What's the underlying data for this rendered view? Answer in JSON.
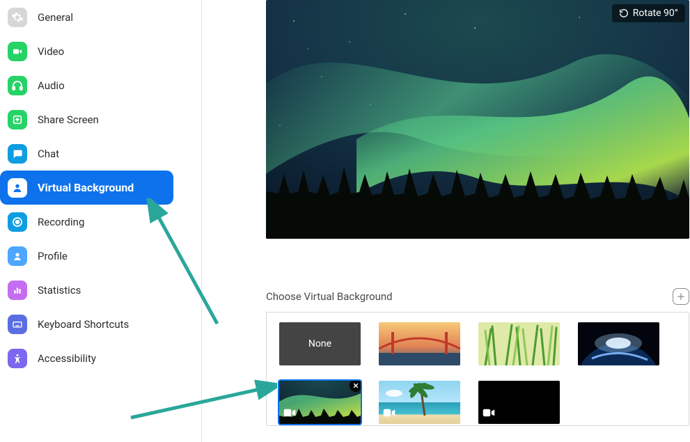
{
  "sidebar": {
    "items": [
      {
        "label": "General",
        "icon": "gear",
        "color": "#d7d7d7",
        "selected": false
      },
      {
        "label": "Video",
        "icon": "video",
        "color": "#25d366",
        "selected": false
      },
      {
        "label": "Audio",
        "icon": "headphones",
        "color": "#25d366",
        "selected": false
      },
      {
        "label": "Share Screen",
        "icon": "share",
        "color": "#25d366",
        "selected": false
      },
      {
        "label": "Chat",
        "icon": "chat",
        "color": "#0e9de0",
        "selected": false
      },
      {
        "label": "Virtual Background",
        "icon": "person",
        "color": "#ffffff",
        "selected": true
      },
      {
        "label": "Recording",
        "icon": "record",
        "color": "#0e9de0",
        "selected": false
      },
      {
        "label": "Profile",
        "icon": "profile",
        "color": "#4da6ff",
        "selected": false
      },
      {
        "label": "Statistics",
        "icon": "stats",
        "color": "#c56cf0",
        "selected": false
      },
      {
        "label": "Keyboard Shortcuts",
        "icon": "keyboard",
        "color": "#5b6ee1",
        "selected": false
      },
      {
        "label": "Accessibility",
        "icon": "a11y",
        "color": "#7b68ee",
        "selected": false
      }
    ]
  },
  "preview": {
    "rotate_label": "Rotate 90°",
    "background_name": "aurora"
  },
  "choose": {
    "label": "Choose Virtual Background"
  },
  "thumbs": [
    {
      "name": "none",
      "label": "None",
      "selected": false,
      "video": false,
      "removable": false
    },
    {
      "name": "bridge",
      "label": "",
      "selected": false,
      "video": false,
      "removable": false
    },
    {
      "name": "grass",
      "label": "",
      "selected": false,
      "video": false,
      "removable": false
    },
    {
      "name": "earth",
      "label": "",
      "selected": false,
      "video": false,
      "removable": false
    },
    {
      "name": "aurora",
      "label": "",
      "selected": true,
      "video": true,
      "removable": true
    },
    {
      "name": "beach",
      "label": "",
      "selected": false,
      "video": true,
      "removable": false
    },
    {
      "name": "black",
      "label": "",
      "selected": false,
      "video": true,
      "removable": false
    }
  ],
  "colors": {
    "accent": "#0e72ec",
    "arrow": "#2aa79b"
  }
}
